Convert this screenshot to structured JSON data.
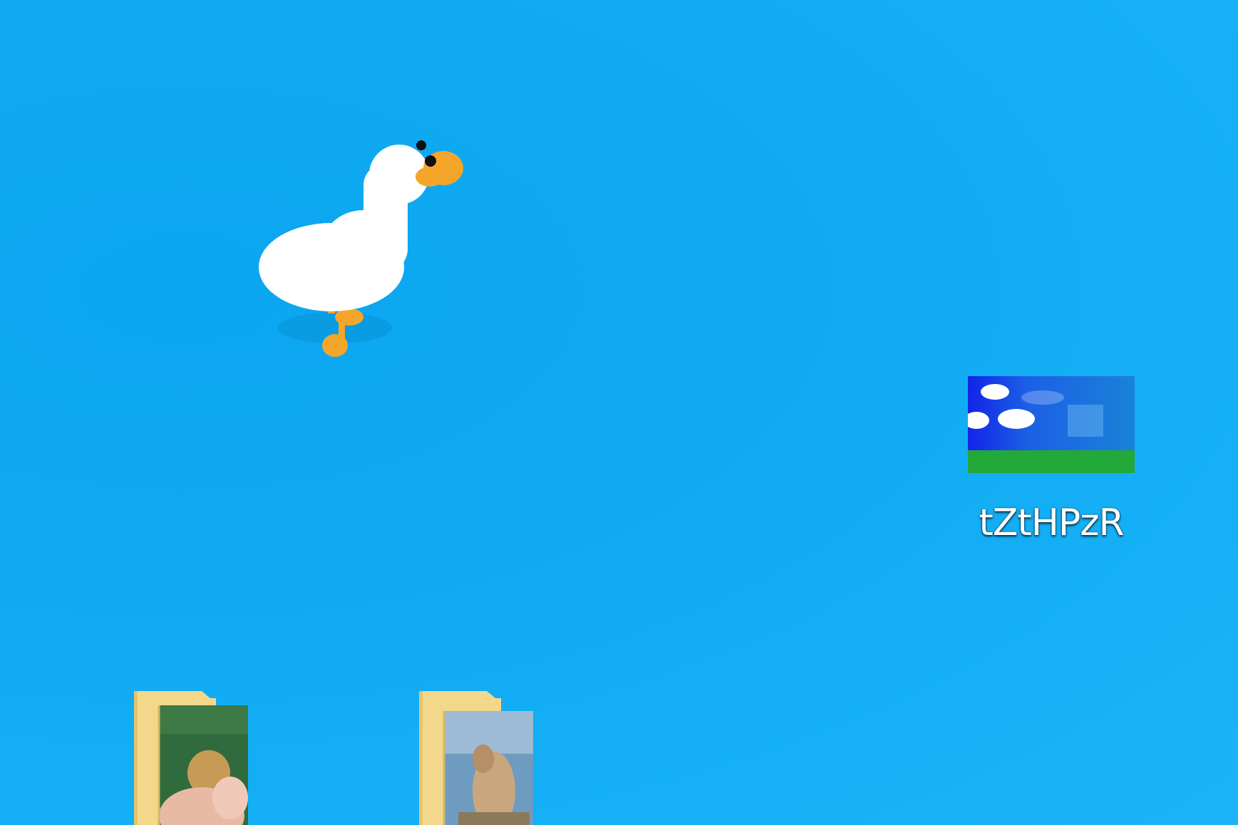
{
  "desktop": {
    "icons": [
      {
        "label": "tZtHPzR",
        "icon": "image-file-thumbnail-icon"
      }
    ],
    "folders": [
      {
        "icon": "folder-with-photo-icon"
      },
      {
        "icon": "folder-with-photo-icon"
      }
    ],
    "goose": {
      "icon": "goose-sprite"
    }
  },
  "colors": {
    "wallpaper": "#10aaf2",
    "goose_body": "#ffffff",
    "goose_beak": "#f4a62a",
    "folder": "#f3d88c"
  }
}
